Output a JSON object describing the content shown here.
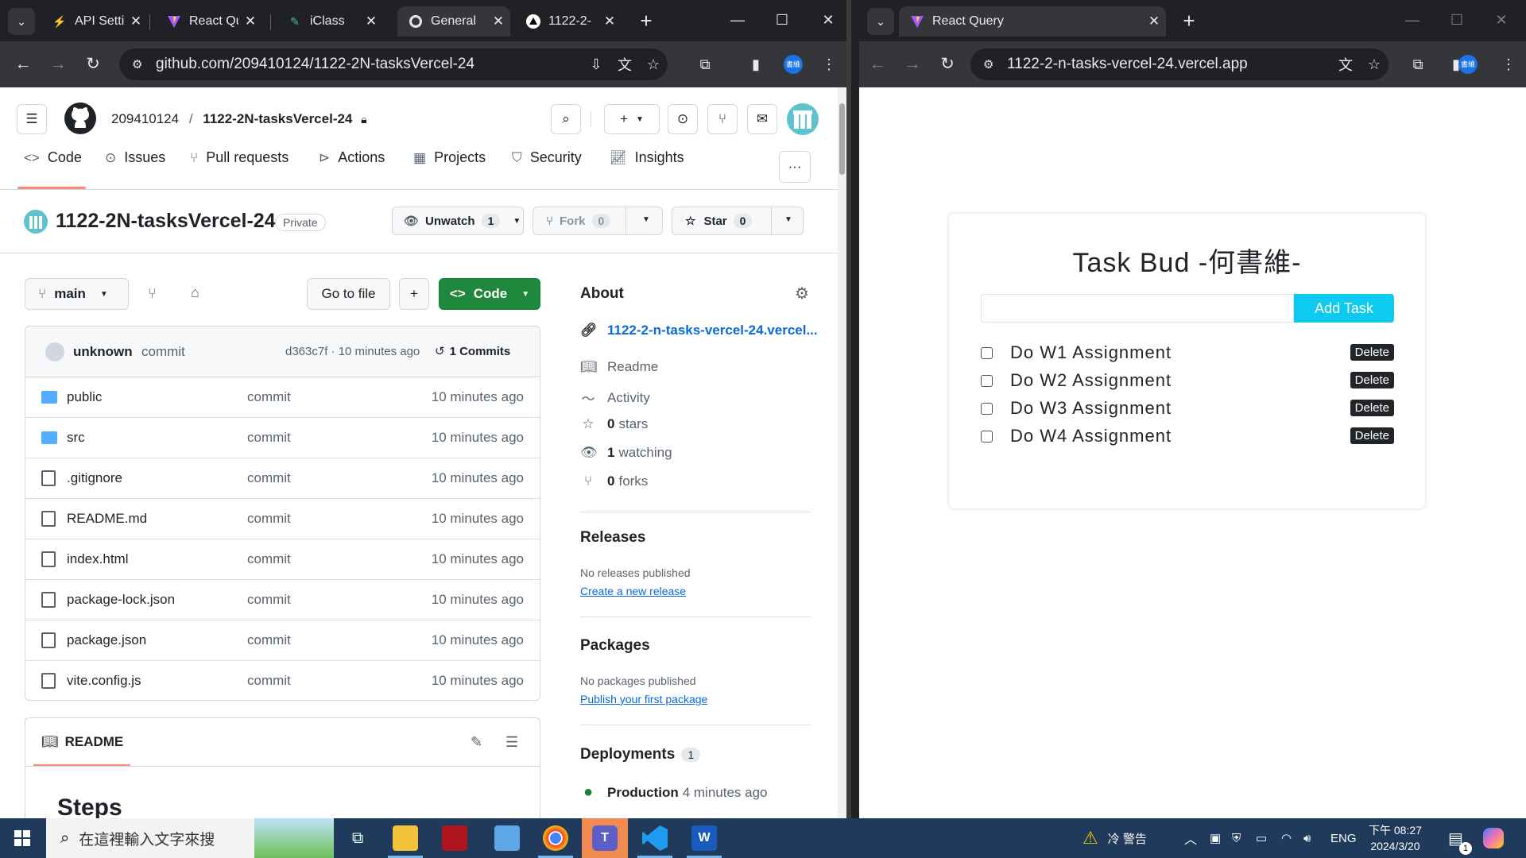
{
  "window_left": {
    "tabs": [
      {
        "label": "API Setti",
        "icon": "bolt-icon"
      },
      {
        "label": "React Qu",
        "icon": "vite-icon"
      },
      {
        "label": "iClass",
        "icon": "iclass-icon"
      },
      {
        "label": "General",
        "icon": "github-icon"
      },
      {
        "label": "1122-2-",
        "icon": "vercel-icon"
      }
    ],
    "url": "github.com/209410124/1122-2N-tasksVercel-24"
  },
  "github": {
    "owner": "209410124",
    "repo_name": "1122-2N-tasksVercel-24",
    "nav": [
      "Code",
      "Issues",
      "Pull requests",
      "Actions",
      "Projects",
      "Security",
      "Insights"
    ],
    "visibility": "Private",
    "unwatch_label": "Unwatch",
    "unwatch_count": "1",
    "fork_label": "Fork",
    "fork_count": "0",
    "star_label": "Star",
    "star_count": "0",
    "branch": "main",
    "go_to_file": "Go to file",
    "code_label": "Code",
    "commit_author": "unknown",
    "commit_message": "commit",
    "commit_meta": "d363c7f · 10 minutes ago",
    "commits_label": "1 Commits",
    "files": [
      {
        "name": "public",
        "type": "folder",
        "message": "commit",
        "age": "10 minutes ago"
      },
      {
        "name": "src",
        "type": "folder",
        "message": "commit",
        "age": "10 minutes ago"
      },
      {
        "name": ".gitignore",
        "type": "file",
        "message": "commit",
        "age": "10 minutes ago"
      },
      {
        "name": "README.md",
        "type": "file",
        "message": "commit",
        "age": "10 minutes ago"
      },
      {
        "name": "index.html",
        "type": "file",
        "message": "commit",
        "age": "10 minutes ago"
      },
      {
        "name": "package-lock.json",
        "type": "file",
        "message": "commit",
        "age": "10 minutes ago"
      },
      {
        "name": "package.json",
        "type": "file",
        "message": "commit",
        "age": "10 minutes ago"
      },
      {
        "name": "vite.config.js",
        "type": "file",
        "message": "commit",
        "age": "10 minutes ago"
      }
    ],
    "readme_tab": "README",
    "readme_heading": "Steps",
    "about": {
      "title": "About",
      "website": "1122-2-n-tasks-vercel-24.vercel...",
      "readme": "Readme",
      "activity": "Activity",
      "stars_count": "0",
      "stars_label": "stars",
      "watching_count": "1",
      "watching_label": "watching",
      "forks_count": "0",
      "forks_label": "forks"
    },
    "releases": {
      "title": "Releases",
      "empty": "No releases published",
      "link": "Create a new release"
    },
    "packages": {
      "title": "Packages",
      "empty": "No packages published",
      "link": "Publish your first package"
    },
    "deployments": {
      "title": "Deployments",
      "count": "1",
      "env": "Production",
      "time": "4 minutes ago"
    }
  },
  "window_right": {
    "tab_label": "React Query",
    "url": "1122-2-n-tasks-vercel-24.vercel.app",
    "profile": "書維"
  },
  "taskapp": {
    "title": "Task Bud -何書維-",
    "add_button": "Add Task",
    "input_value": "",
    "delete_label": "Delete",
    "tasks": [
      "Do W1 Assignment",
      "Do W2 Assignment",
      "Do W3 Assignment",
      "Do W4 Assignment"
    ]
  },
  "taskbar": {
    "search_placeholder": "在這裡輸入文字來搜",
    "weather": "冷 警告",
    "lang": "ENG",
    "time": "下午 08:27",
    "date": "2024/3/20",
    "notif_count": "1"
  }
}
